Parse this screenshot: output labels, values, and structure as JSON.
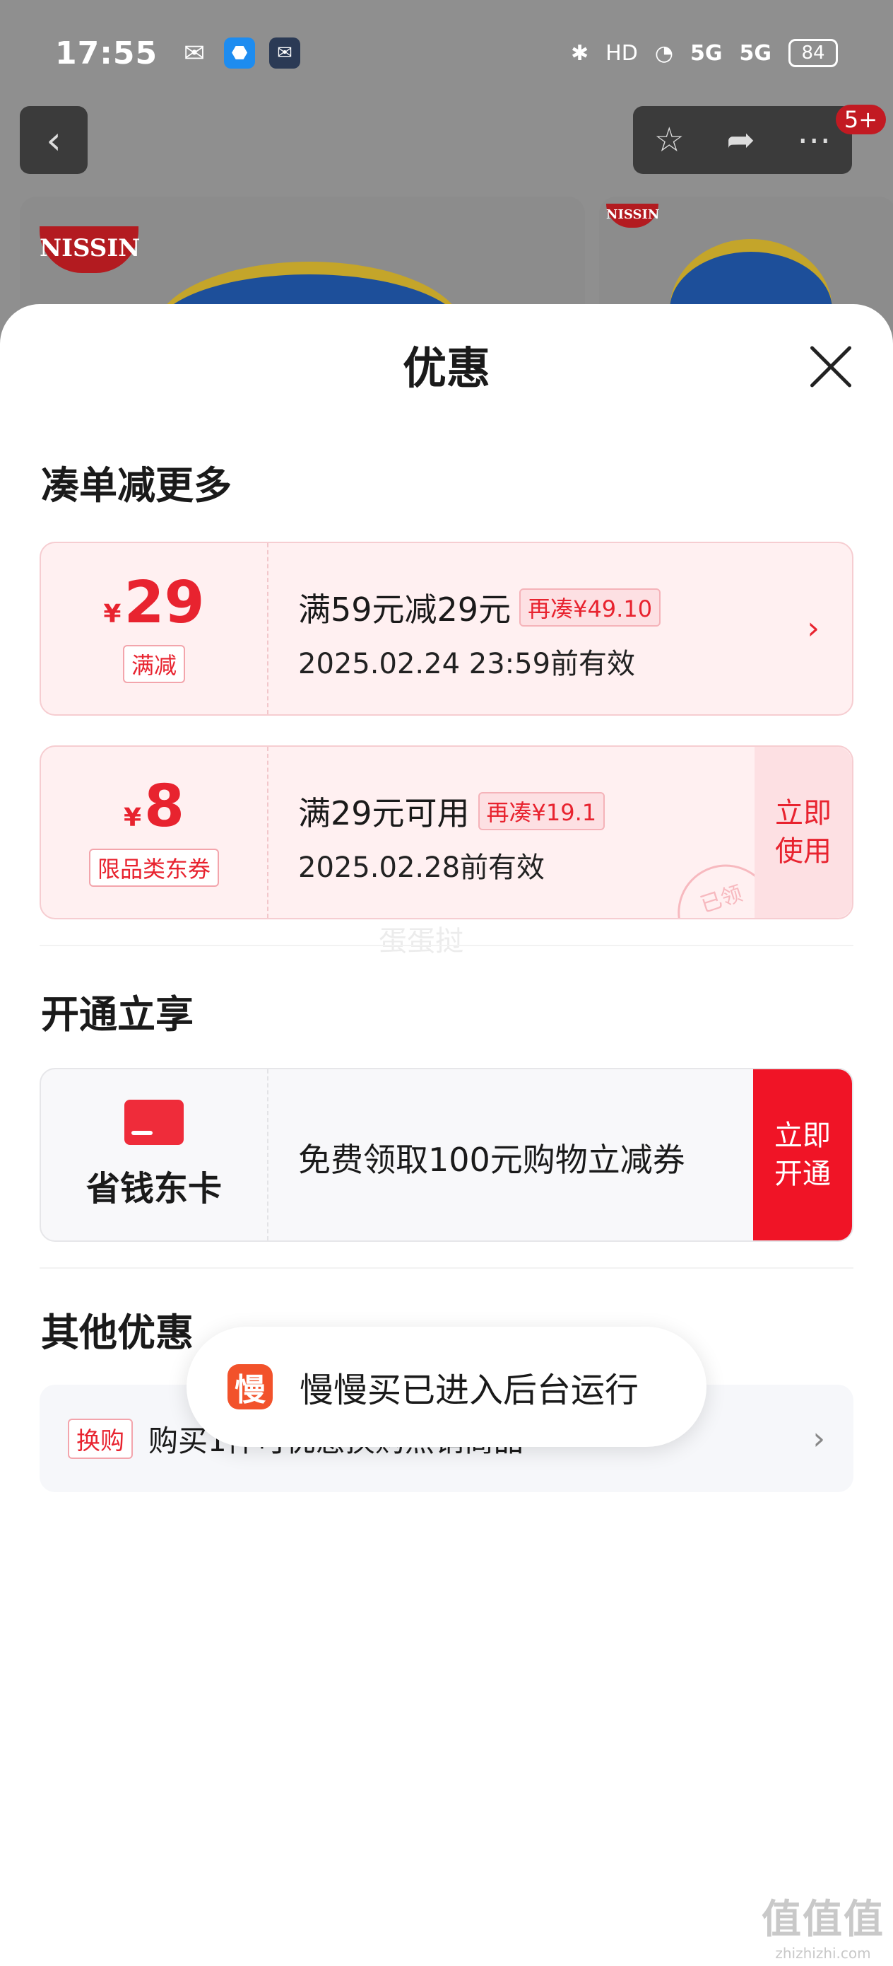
{
  "status_bar": {
    "time": "17:55",
    "signal1": "5G",
    "signal2": "5G",
    "battery": "84"
  },
  "nav": {
    "badge": "5+"
  },
  "products": {
    "brand_left": "NISSIN",
    "brand_right": "NISSIN"
  },
  "sheet": {
    "title": "优惠",
    "sections": {
      "more": "凑单减更多",
      "member": "开通立享",
      "other": "其他优惠"
    }
  },
  "coupons": [
    {
      "currency": "¥",
      "amount": "29",
      "tag": "满减",
      "condition": "满59元减29元",
      "again": "再凑¥49.10",
      "validity": "2025.02.24 23:59前有效"
    },
    {
      "currency": "¥",
      "amount": "8",
      "tag": "限品类东券",
      "condition": "满29元可用",
      "again": "再凑¥19.1",
      "validity": "2025.02.28前有效",
      "action": "立即使用",
      "stamp": "已领"
    }
  ],
  "member_card": {
    "name": "省钱东卡",
    "desc": "免费领取100元购物立减券",
    "action": "立即开通"
  },
  "other_offer": {
    "tag": "换购",
    "text": "购买1件可优惠换购热销商品"
  },
  "toast": {
    "icon_char": "慢",
    "text": "慢慢买已进入后台运行"
  },
  "watermarks": {
    "center": "蛋蛋挝",
    "corner": "值值值",
    "corner_url": "zhizhizhi.com"
  },
  "colors": {
    "accent_red": "#e8232f",
    "button_red": "#f01426",
    "coupon_bg": "#fff0f1"
  }
}
